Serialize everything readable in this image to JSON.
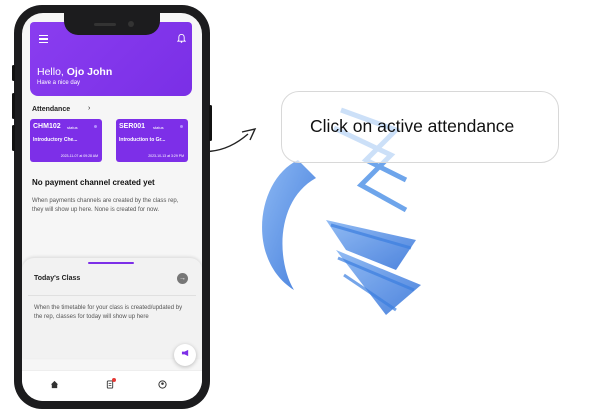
{
  "app": {
    "greeting_prefix": "Hello, ",
    "user_name": "Ojo John",
    "tagline": "Have a nice day"
  },
  "attendance": {
    "title": "Attendance",
    "cards": [
      {
        "code": "CHM102",
        "status": "status",
        "course": "Introductory Che...",
        "time": "2023-11-07 at 09:28 AM"
      },
      {
        "code": "SER001",
        "status": "status",
        "course": "Introduction to Gr...",
        "time": "2023-10-13 at 3:29 PM"
      }
    ]
  },
  "payments": {
    "empty_title": "No payment channel created yet",
    "empty_desc": "When payments channels are created by the class rep, they will show up here. None is created for now."
  },
  "today": {
    "title": "Today's Class",
    "desc": "When the timetable for your class is created/updated by the rep, classes for today will show up here"
  },
  "icons": {
    "menu": "menu-icon",
    "notification": "bell-icon",
    "chevron": "chevron-right-icon",
    "arrow": "arrow-right-icon",
    "fab": "megaphone-icon",
    "nav": [
      "home-icon",
      "document-icon",
      "profile-icon"
    ]
  },
  "callout": {
    "text": "Click on active attendance"
  },
  "colors": {
    "brand_purple": "#7d2fe8",
    "logo_blue": "#4a8fe7",
    "badge_red": "#e53935"
  }
}
